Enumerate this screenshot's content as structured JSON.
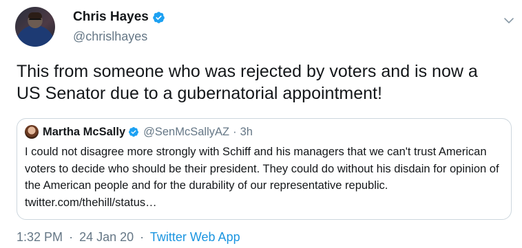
{
  "author": {
    "display_name": "Chris Hayes",
    "handle": "@chrislhayes",
    "verified_icon": "verified-badge-icon"
  },
  "tweet": {
    "text": "This from someone who was rejected by voters and is now a US Senator due to a gubernatorial appointment!"
  },
  "quoted_tweet": {
    "display_name": "Martha McSally",
    "handle": "@SenMcSallyAZ",
    "separator": "·",
    "time": "3h",
    "text": "I could not disagree more strongly with Schiff and his managers that we can't trust American voters to decide who should be their president. They could do without his disdain for opinion of the American people and for the durability of our representative republic. twitter.com/thehill/status…"
  },
  "meta": {
    "time": "1:32 PM",
    "separator": "·",
    "date": "24 Jan 20",
    "source": "Twitter Web App"
  },
  "colors": {
    "verified_blue": "#1da1f2",
    "link_blue": "#1b95e0",
    "secondary_text": "#657786",
    "border": "#ccd6dd"
  }
}
